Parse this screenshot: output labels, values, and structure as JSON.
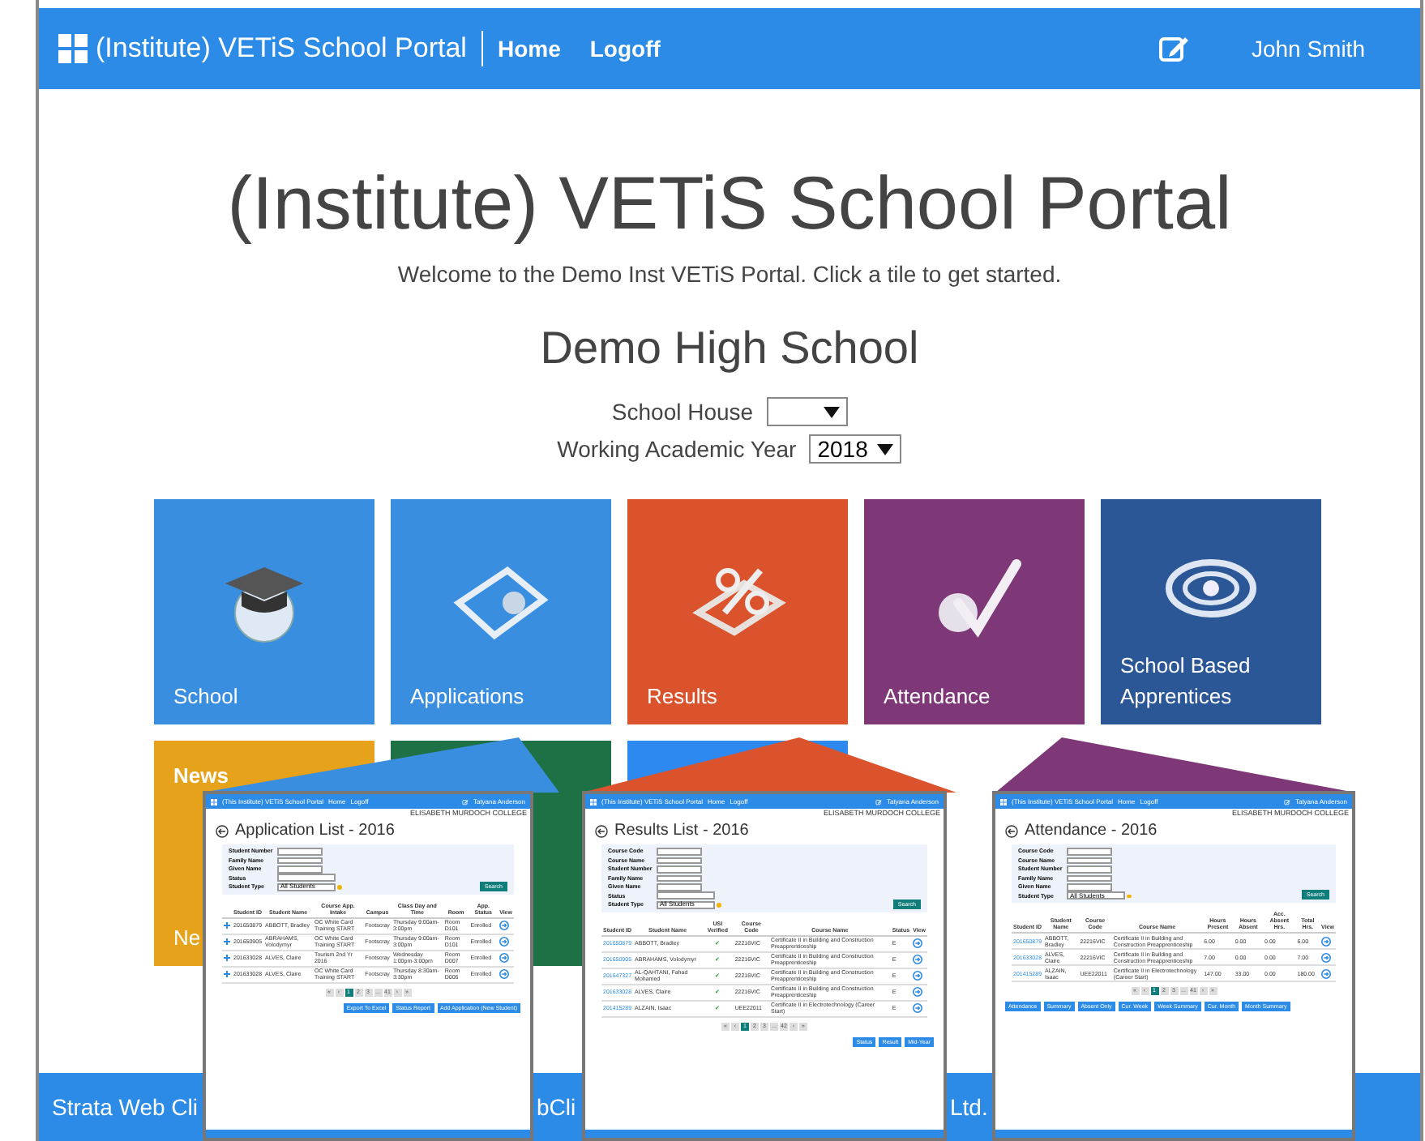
{
  "header": {
    "title": "(Institute) VETiS School Portal",
    "nav": [
      {
        "label": "Home"
      },
      {
        "label": "Logoff"
      }
    ],
    "user": "John Smith"
  },
  "hero": {
    "title": "(Institute) VETiS School Portal",
    "welcome": "Welcome to the Demo Inst VETiS Portal. Click a tile to get started.",
    "school": "Demo High School"
  },
  "filters": [
    {
      "label": "School House"
    },
    {
      "label": "Working Academic Year",
      "value": "2018"
    }
  ],
  "tiles": [
    {
      "kind": "cap",
      "caption": "School",
      "color": "#3a8ee0"
    },
    {
      "kind": "diamond",
      "caption": "Applications",
      "color": "#3a8ee0"
    },
    {
      "kind": "percent",
      "caption": "Results",
      "color": "#da532c"
    },
    {
      "kind": "check",
      "caption": "Attendance",
      "color": "#7e3878"
    },
    {
      "kind": "rings",
      "caption": "School Based Apprentices",
      "color": "#2b5797"
    },
    {
      "kind": "plain",
      "title": "News",
      "caption": "Ne",
      "color": "#e5a21a"
    },
    {
      "kind": "plain",
      "color": "#1e7145"
    },
    {
      "kind": "plain",
      "color": "#2d89ef"
    }
  ],
  "footer": {
    "fragments": [
      "Strata Web Cli",
      "bCli",
      "Ltd."
    ]
  },
  "insets": [
    {
      "portal": "(This Institute) VETiS School Portal",
      "nav": [
        "Home",
        "Logoff"
      ],
      "user": "Tatyana Anderson",
      "college": "ELISABETH MURDOCH COLLEGE",
      "title": "Application List - 2016",
      "row_expander": true,
      "id_links": false,
      "fields": [
        {
          "label": "Student Number",
          "kind": "text"
        },
        {
          "label": "Family Name",
          "kind": "text"
        },
        {
          "label": "Given Name",
          "kind": "text"
        },
        {
          "label": "Status",
          "kind": "select"
        },
        {
          "label": "Student Type",
          "kind": "select",
          "value": "All Students"
        }
      ],
      "search": "Search",
      "columns": [
        "Student ID",
        "Student Name",
        "Course App. Intake",
        "Campus",
        "Class Day and Time",
        "Room",
        "App. Status",
        "View"
      ],
      "rows": [
        [
          "201650879",
          "ABBOTT, Bradley",
          "OC White Card Training START",
          "Footscray",
          "Thursday 9:00am-3:00pm",
          "Room D101",
          "Enrolled"
        ],
        [
          "201650905",
          "ABRAHAMS, Volodymyr",
          "OC White Card Training START",
          "Footscray",
          "Thursday 9:00am-3:00pm",
          "Room D101",
          "Enrolled"
        ],
        [
          "201633028",
          "ALVES, Claire",
          "Tourism 2nd Yr 2016",
          "Footscray",
          "Wednesday 1:00pm-3:00pm",
          "Room D007",
          "Enrolled"
        ],
        [
          "201633028",
          "ALVES, Claire",
          "OC White Card Training START",
          "Footscray",
          "Thursday 8:30am-3:30pm",
          "Room D006",
          "Enrolled"
        ]
      ],
      "pages": [
        {
          "label": "«",
          "selected": false
        },
        {
          "label": "‹",
          "selected": false
        },
        {
          "label": "1",
          "selected": true
        },
        {
          "label": "2",
          "selected": false
        },
        {
          "label": "3",
          "selected": false
        },
        {
          "label": "...",
          "selected": false
        },
        {
          "label": "41",
          "selected": false
        },
        {
          "label": "›",
          "selected": false
        },
        {
          "label": "»",
          "selected": false
        }
      ],
      "buttons": [
        "Export To Excel",
        "Status Report",
        "Add Application (New Student)"
      ]
    },
    {
      "portal": "(This Institute) VETiS School Portal",
      "nav": [
        "Home",
        "Logoff"
      ],
      "user": "Tatyana Anderson",
      "college": "ELISABETH MURDOCH COLLEGE",
      "title": "Results List - 2016",
      "row_expander": false,
      "id_links": true,
      "fields": [
        {
          "label": "Course Code",
          "kind": "text"
        },
        {
          "label": "Course Name",
          "kind": "text"
        },
        {
          "label": "Student Number",
          "kind": "text"
        },
        {
          "label": "Family Name",
          "kind": "text"
        },
        {
          "label": "Given Name",
          "kind": "text"
        },
        {
          "label": "Status",
          "kind": "select"
        },
        {
          "label": "Student Type",
          "kind": "select",
          "value": "All Students"
        }
      ],
      "search": "Search",
      "columns": [
        "Student ID",
        "Student Name",
        "USI Verified",
        "Course Code",
        "Course Name",
        "Status",
        "View"
      ],
      "rows": [
        [
          "201650879",
          "ABBOTT, Bradley",
          "✔",
          "22216VIC",
          "Certificate II in Building and Construction Preapprenticeship",
          "E"
        ],
        [
          "201650905",
          "ABRAHAMS, Volodymyr",
          "✔",
          "22216VIC",
          "Certificate II in Building and Construction Preapprenticeship",
          "E"
        ],
        [
          "201647327",
          "AL-QAHTANI, Fahad Mohamed",
          "✔",
          "22216VIC",
          "Certificate II in Building and Construction Preapprenticeship",
          "E"
        ],
        [
          "201633028",
          "ALVES, Claire",
          "✔",
          "22216VIC",
          "Certificate II in Building and Construction Preapprenticeship",
          "E"
        ],
        [
          "201415289",
          "ALZAIN, Isaac",
          "✔",
          "UEE22011",
          "Certificate II in Electrotechnology (Career Start)",
          "E"
        ]
      ],
      "pages": [
        {
          "label": "«",
          "selected": false
        },
        {
          "label": "‹",
          "selected": false
        },
        {
          "label": "1",
          "selected": true
        },
        {
          "label": "2",
          "selected": false
        },
        {
          "label": "3",
          "selected": false
        },
        {
          "label": "...",
          "selected": false
        },
        {
          "label": "42",
          "selected": false
        },
        {
          "label": "›",
          "selected": false
        },
        {
          "label": "»",
          "selected": false
        }
      ],
      "buttons": [
        "Status",
        "Result",
        "Mid-Year"
      ]
    },
    {
      "portal": "(This Institute) VETiS School Portal",
      "nav": [
        "Home",
        "Logoff"
      ],
      "user": "Tatyana Anderson",
      "college": "ELISABETH MURDOCH COLLEGE",
      "title": "Attendance - 2016",
      "row_expander": false,
      "id_links": true,
      "fields": [
        {
          "label": "Course Code",
          "kind": "text"
        },
        {
          "label": "Course Name",
          "kind": "text"
        },
        {
          "label": "Student Number",
          "kind": "text"
        },
        {
          "label": "Family Name",
          "kind": "text"
        },
        {
          "label": "Given Name",
          "kind": "text"
        },
        {
          "label": "Student Type",
          "kind": "select",
          "value": "All Students"
        }
      ],
      "search": "Search",
      "columns": [
        "Student ID",
        "Student Name",
        "Course Code",
        "Course Name",
        "Hours Present",
        "Hours Absent",
        "Acc. Absent Hrs.",
        "Total Hrs.",
        "View"
      ],
      "rows": [
        [
          "201650879",
          "ABBOTT, Bradley",
          "22216VIC",
          "Certificate II in Building and Construction Preapprenticeship",
          "6.00",
          "0.00",
          "0.00",
          "6.00"
        ],
        [
          "201633028",
          "ALVES, Claire",
          "22216VIC",
          "Certificate II in Building and Construction Preapprenticeship",
          "7.00",
          "0.00",
          "0.00",
          "7.00"
        ],
        [
          "201415289",
          "ALZAIN, Isaac",
          "UEE22011",
          "Certificate II in Electrotechnology (Career Start)",
          "147.00",
          "33.00",
          "0.00",
          "180.00"
        ]
      ],
      "pages": [
        {
          "label": "«",
          "selected": false
        },
        {
          "label": "‹",
          "selected": false
        },
        {
          "label": "1",
          "selected": true
        },
        {
          "label": "2",
          "selected": false
        },
        {
          "label": "3",
          "selected": false
        },
        {
          "label": "...",
          "selected": false
        },
        {
          "label": "41",
          "selected": false
        },
        {
          "label": "›",
          "selected": false
        },
        {
          "label": "»",
          "selected": false
        }
      ],
      "buttons": [
        "Attendance",
        "Summary",
        "Absent Only",
        "Cur. Week",
        "Week Summary",
        "Cur. Month",
        "Month Summary"
      ]
    }
  ]
}
